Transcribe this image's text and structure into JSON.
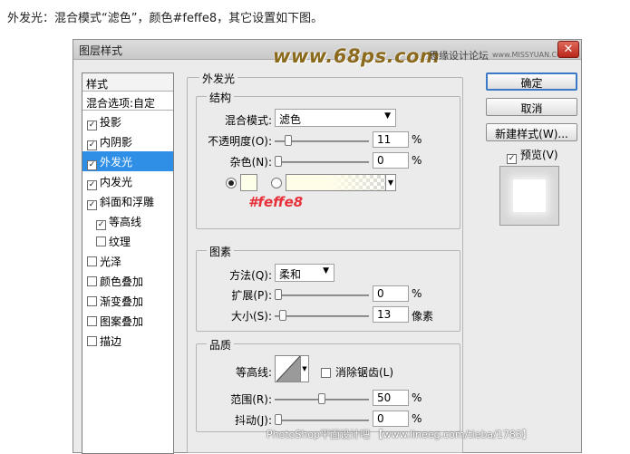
{
  "caption": "外发光：混合模式“滤色”，颜色#feffe8，其它设置如下图。",
  "dialog": {
    "title": "图层样式",
    "close_glyph": "✕",
    "watermark": "www.68ps.com",
    "watermark_forum": "思缘设计论坛",
    "watermark_site": "www.MISSYUAN.COM"
  },
  "left_panel": {
    "header": "样式",
    "blend_options": "混合选项:自定",
    "items": [
      {
        "label": "投影",
        "checked": true,
        "sub": false,
        "selected": false
      },
      {
        "label": "内阴影",
        "checked": true,
        "sub": false,
        "selected": false
      },
      {
        "label": "外发光",
        "checked": true,
        "sub": false,
        "selected": true
      },
      {
        "label": "内发光",
        "checked": true,
        "sub": false,
        "selected": false
      },
      {
        "label": "斜面和浮雕",
        "checked": true,
        "sub": false,
        "selected": false
      },
      {
        "label": "等高线",
        "checked": true,
        "sub": true,
        "selected": false
      },
      {
        "label": "纹理",
        "checked": false,
        "sub": true,
        "selected": false
      },
      {
        "label": "光泽",
        "checked": false,
        "sub": false,
        "selected": false
      },
      {
        "label": "颜色叠加",
        "checked": false,
        "sub": false,
        "selected": false
      },
      {
        "label": "渐变叠加",
        "checked": false,
        "sub": false,
        "selected": false
      },
      {
        "label": "图案叠加",
        "checked": false,
        "sub": false,
        "selected": false
      },
      {
        "label": "描边",
        "checked": false,
        "sub": false,
        "selected": false
      }
    ]
  },
  "outer_glow": {
    "section_title": "外发光",
    "structure": {
      "title": "结构",
      "blend_mode_label": "混合模式:",
      "blend_mode_value": "滤色",
      "opacity_label": "不透明度(O):",
      "opacity_value": "11",
      "opacity_fraction": 0.11,
      "noise_label": "杂色(N):",
      "noise_value": "0",
      "noise_fraction": 0,
      "percent": "%",
      "glow_color": "#feffe8",
      "color_annotation": "#feffe8"
    },
    "elements": {
      "title": "图素",
      "technique_label": "方法(Q):",
      "technique_value": "柔和",
      "spread_label": "扩展(P):",
      "spread_value": "0",
      "spread_fraction": 0,
      "size_label": "大小(S):",
      "size_value": "13",
      "size_fraction": 0.052,
      "size_unit": "像素",
      "percent": "%"
    },
    "quality": {
      "title": "品质",
      "contour_label": "等高线:",
      "antialias_label": "消除锯齿(L)",
      "range_label": "范围(R):",
      "range_value": "50",
      "range_fraction": 0.5,
      "jitter_label": "抖动(J):",
      "jitter_value": "0",
      "jitter_fraction": 0,
      "percent": "%"
    }
  },
  "right_panel": {
    "ok_label": "确定",
    "cancel_label": "取消",
    "new_style_label": "新建样式(W)...",
    "preview_label": "预览(V)"
  },
  "bottom_watermark": "PhotoShop平面设计吧 【www.lineeg.com/tieba/1783】",
  "colors": {
    "selection": "#2f8fe6",
    "annotation": "#e8303a",
    "watermark": "#8b6a1e"
  }
}
